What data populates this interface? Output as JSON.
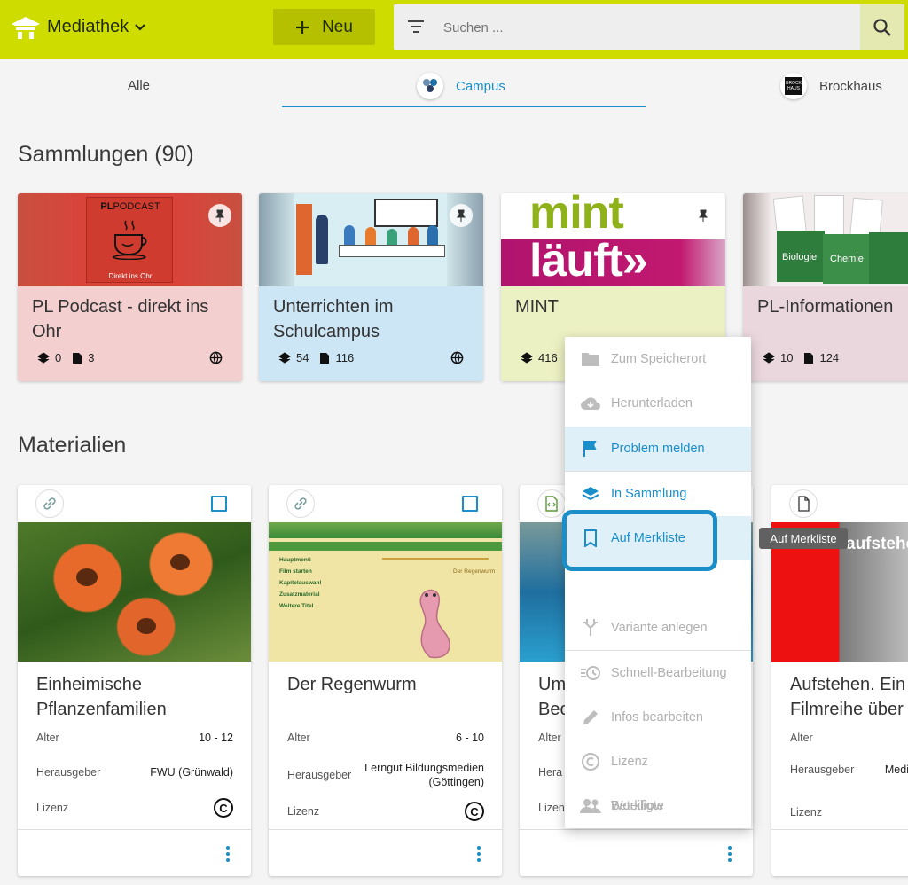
{
  "header": {
    "app_title": "Mediathek",
    "new_label": "Neu",
    "search_placeholder": "Suchen ...",
    "accent_color": "#cfdc00"
  },
  "tabs": [
    {
      "label": "Alle"
    },
    {
      "label": "Campus",
      "active": true
    },
    {
      "label": "Brockhaus",
      "icon_text": "BROCK HAUS"
    }
  ],
  "collections_heading": "Sammlungen (90)",
  "collections": [
    {
      "title": "PL Podcast - direkt ins Ohr",
      "sub_collections": "0",
      "materials": "3",
      "color": "#f3cfcf",
      "image_text": "PODCAST",
      "image_text2": "Direkt ins Ohr"
    },
    {
      "title": "Unterrichten im Schulcampus",
      "sub_collections": "54",
      "materials": "116",
      "color": "#cde6f6"
    },
    {
      "title": "MINT",
      "sub_collections": "416",
      "materials": "",
      "color": "#ecf1c3",
      "image_text": "mint",
      "image_text2": "läuft»"
    },
    {
      "title": "PL-Informationen",
      "sub_collections": "10",
      "materials": "124",
      "color": "#ead7dd",
      "image_text": "Biologie",
      "image_text2": "Chemie"
    }
  ],
  "materials_heading": "Materialien",
  "materials": [
    {
      "type_icon": "link-icon",
      "title": "Einheimische Pflanzenfamilien",
      "alter_label": "Alter",
      "alter": "10 - 12",
      "hrsg_label": "Herausgeber",
      "hrsg": "FWU (Grünwald)",
      "lizenz_label": "Lizenz"
    },
    {
      "type_icon": "link-icon",
      "title": "Der Regenwurm",
      "alter_label": "Alter",
      "alter": "6 - 10",
      "hrsg_label": "Herausgeber",
      "hrsg": "Lerngut Bildungsmedien (Göttingen)",
      "lizenz_label": "Lizenz",
      "menu_items": [
        "Hauptmenü",
        "Film starten",
        "Kapitelauswahl",
        "Zusatzmaterial",
        "Weitere Titel"
      ],
      "thumb_label": "Der Regenwurm"
    },
    {
      "type_icon": "code-file-icon",
      "title": "Um Bec",
      "alter_label": "Alter",
      "hrsg_label": "Hera",
      "lizenz_label": "Lizen"
    },
    {
      "type_icon": "file-icon",
      "title": "Aufstehen. Ein Filmreihe über",
      "alter_label": "Alter",
      "hrsg_label": "Herausgeber",
      "hrsg": "Medienpr",
      "lizenz_label": "Lizenz",
      "thumb_label": "aufstehe"
    }
  ],
  "context_menu": {
    "items": [
      {
        "label": "Zum Speicherort",
        "icon": "folder-icon"
      },
      {
        "label": "Herunterladen",
        "icon": "cloud-download-icon"
      },
      {
        "label": "Problem melden",
        "icon": "flag-icon"
      },
      {
        "label": "In Sammlung",
        "icon": "layers-icon"
      },
      {
        "label": "Auf Merkliste",
        "icon": "bookmark-icon"
      },
      {
        "label": "Variante anlegen",
        "icon": "fork-icon"
      },
      {
        "label": "Schnell-Bearbeitung",
        "icon": "quick-edit-icon"
      },
      {
        "label": "Infos bearbeiten",
        "icon": "pencil-icon"
      },
      {
        "label": "Lizenz",
        "icon": "copyright-icon"
      },
      {
        "label": "Beteiligte",
        "icon": "people-icon"
      },
      {
        "label": "Workflow",
        "icon": "workflow-icon"
      }
    ]
  },
  "tooltip": "Auf Merkliste"
}
